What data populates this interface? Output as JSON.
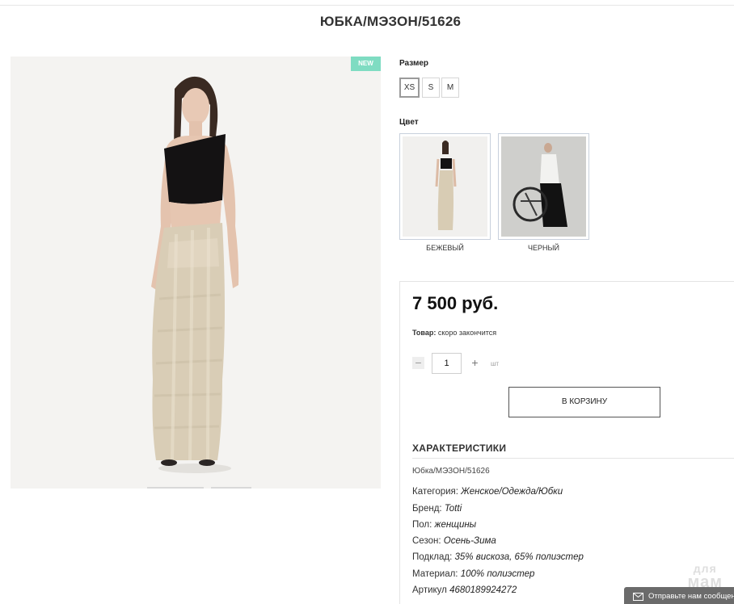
{
  "product": {
    "title": "ЮБКА/МЭЗОН/51626",
    "badge": "NEW"
  },
  "size": {
    "label": "Размер",
    "options": [
      "XS",
      "S",
      "M"
    ],
    "selected": "XS"
  },
  "color": {
    "label": "Цвет",
    "options": [
      {
        "name": "БЕЖЕВЫЙ"
      },
      {
        "name": "ЧЕРНЫЙ"
      }
    ]
  },
  "buy": {
    "price": "7 500 руб.",
    "stock_label": "Товар:",
    "stock_value": "скоро закончится",
    "qty": "1",
    "unit": "шт",
    "cart_label": "В КОРЗИНУ"
  },
  "specs": {
    "title": "ХАРАКТЕРИСТИКИ",
    "sku_line": "Юбка/МЭЗОН/51626",
    "rows": [
      {
        "key": "Категория:",
        "value": "Женское/Одежда/Юбки"
      },
      {
        "key": "Бренд:",
        "value": "Totti"
      },
      {
        "key": "Пол:",
        "value": "женщины"
      },
      {
        "key": "Сезон:",
        "value": "Осень-Зима"
      },
      {
        "key": "Подклад:",
        "value": "35% вискоза, 65% полиэстер"
      },
      {
        "key": "Материал:",
        "value": "100% полиэстер"
      },
      {
        "key": "Артикул",
        "value": "4680189924272"
      }
    ]
  },
  "watermark": {
    "line1": "для",
    "line2": "мам"
  },
  "feedback": {
    "label": "Отправьте нам сообщение"
  },
  "colors": {
    "badge": "#7fdcc2",
    "feedback_bg": "#6b6b6b"
  }
}
